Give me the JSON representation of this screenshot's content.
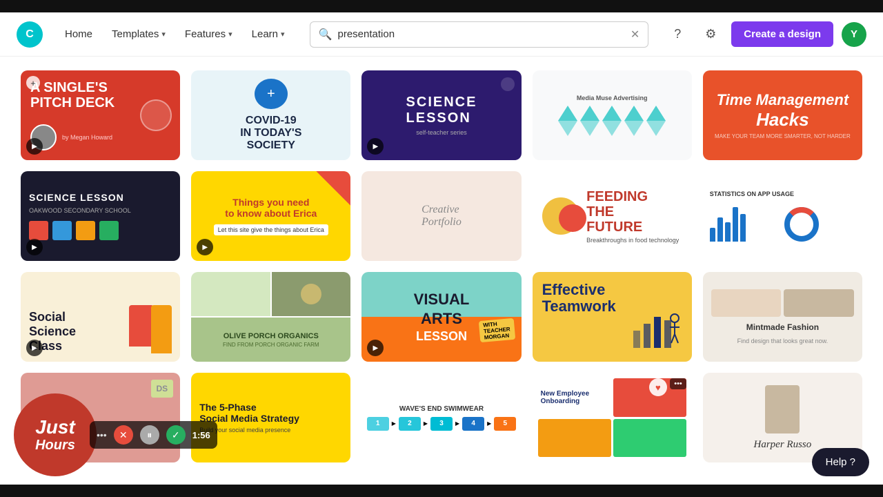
{
  "topBar": {},
  "navbar": {
    "logo": "C",
    "home": "Home",
    "templates": "Templates",
    "features": "Features",
    "learn": "Learn",
    "search_placeholder": "presentation",
    "create_btn": "Create a design",
    "avatar_letter": "Y"
  },
  "grid": {
    "cards": [
      {
        "id": 1,
        "title": "A Single's Pitch Deck",
        "theme": "c1",
        "has_play": true,
        "has_add": true
      },
      {
        "id": 2,
        "title": "COVID-19 In Today's Society",
        "theme": "c2",
        "has_play": false
      },
      {
        "id": 3,
        "title": "Science Lesson",
        "theme": "c3",
        "has_play": true
      },
      {
        "id": 4,
        "title": "Media Muse Advertising",
        "theme": "c4"
      },
      {
        "id": 5,
        "title": "Time Management Hacks",
        "theme": "c5"
      },
      {
        "id": 6,
        "title": "Science Lesson",
        "theme": "c6",
        "has_play": true
      },
      {
        "id": 7,
        "title": "Things You Need to Know About Erica",
        "theme": "c7",
        "has_play": true
      },
      {
        "id": 8,
        "title": "Creative Portfolio",
        "theme": "c8"
      },
      {
        "id": 9,
        "title": "Feeding the Future",
        "theme": "c9"
      },
      {
        "id": 10,
        "title": "Statistics on App Usage",
        "theme": "c10"
      },
      {
        "id": 11,
        "title": "Social Science Class",
        "theme": "c11",
        "has_play": true
      },
      {
        "id": 12,
        "title": "Olive Porch Organics",
        "theme": "c12"
      },
      {
        "id": 13,
        "title": "Visual Arts with Teacher Morgan",
        "theme": "c13",
        "has_play": true
      },
      {
        "id": 14,
        "title": "Effective Teamwork",
        "theme": "c14"
      },
      {
        "id": 15,
        "title": "Mintmade Fashion",
        "theme": "c15"
      },
      {
        "id": 16,
        "title": "Just Hours",
        "theme": "c16"
      },
      {
        "id": 17,
        "title": "The 5-Phase Social Media Strategy",
        "theme": "c17"
      },
      {
        "id": 18,
        "title": "Wave's End Swimwear",
        "theme": "c18"
      },
      {
        "id": 19,
        "title": "New Employee Onboarding",
        "theme": "c19",
        "has_heart": true,
        "has_more": true
      },
      {
        "id": 20,
        "title": "Harper Russo",
        "theme": "c20"
      }
    ]
  },
  "floating": {
    "circle_line1": "Just",
    "circle_line2": "Hours",
    "time": "1:56",
    "help": "Help ?"
  }
}
